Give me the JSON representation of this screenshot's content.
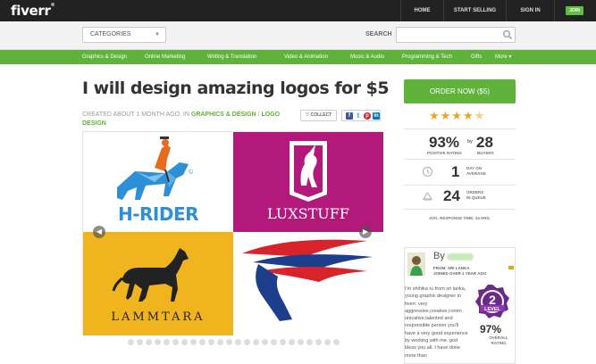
{
  "header": {
    "logo": "fiverr",
    "logo_mark": "®",
    "nav": [
      "HOME",
      "START SELLING",
      "SIGN IN"
    ],
    "join": "JOIN"
  },
  "search": {
    "categories_label": "CATEGORIES",
    "search_label": "SEARCH",
    "placeholder": ""
  },
  "category_bar": [
    "Graphics & Design",
    "Online Marketing",
    "Writing & Translation",
    "Video & Animation",
    "Music & Audio",
    "Programming & Tech",
    "Gifts",
    "More ▾"
  ],
  "gig": {
    "title": "I will design amazing logos for $5",
    "meta_prefix": "CREATED ABOUT 1 MONTH AGO, IN ",
    "meta_category": "GRAPHICS & DESIGN",
    "meta_sep": " / ",
    "meta_subcategory": "LOGO DESIGN",
    "collect_label": "COLLECT",
    "share_icons": [
      "facebook-icon",
      "twitter-icon",
      "pinterest-icon",
      "linkedin-icon"
    ]
  },
  "gallery": {
    "tiles": [
      {
        "text": "H-RIDER",
        "mark": "©"
      },
      {
        "text": "LUXSTUFF"
      },
      {
        "text": "LAMMTARA"
      },
      {
        "text": ""
      }
    ],
    "dot_count": 24,
    "colors": {
      "hrider_blue": "#2e8fd6",
      "luxstuff_magenta": "#b3197b",
      "lammtara_yellow": "#f0b51e",
      "flag_red": "#d8232a",
      "flag_navy": "#1d3e8c"
    }
  },
  "sidebar": {
    "order_label": "ORDER NOW ($5)",
    "rating_stars": 4.5,
    "positive_pct": "93%",
    "positive_label": "POSITIVE RATING",
    "by": "by",
    "buyers": "28",
    "buyers_label": "BUYERS",
    "day_num": "1",
    "day_label_1": "DAY ON",
    "day_label_2": "AVERAGE",
    "orders_num": "24",
    "orders_label_1": "ORDERS",
    "orders_label_2": "IN QUEUE",
    "response_time": "AVG. RESPONSE TIME: 24 HRS.",
    "accent": "#5fb23a"
  },
  "seller": {
    "by_label": "By",
    "from_line": "FROM: SRI LANKA",
    "joined_line": "JOINED OVER 1 YEAR AGO",
    "description": "I'm shihika ru from sri lanka, young graphic designer in fiverr. very aggressive,creative,comm unicative,talented and responsible person you'll have a very good experience by working with me. god bless you all. I have done more than",
    "level_num": "2",
    "level_label": "LEVEL",
    "overall_pct": "97%",
    "overall_label_1": "OVERALL",
    "overall_label_2": "RATING"
  }
}
